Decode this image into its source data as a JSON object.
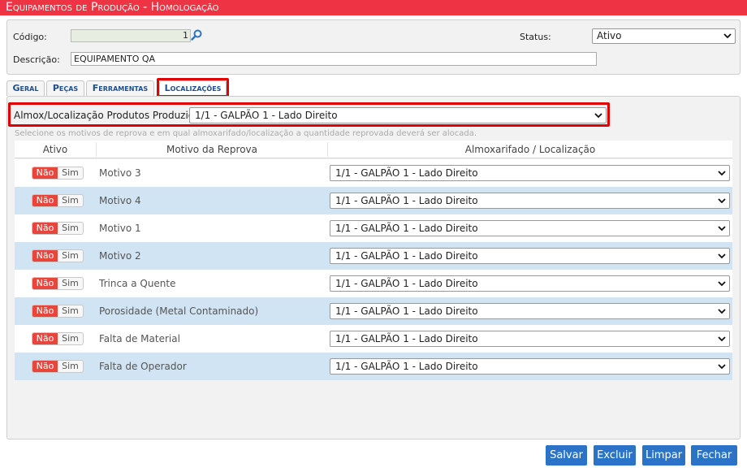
{
  "title": "Equipamentos de Produção  - Homologação",
  "header": {
    "codigo_label": "Código:",
    "codigo_value": "1",
    "descricao_label": "Descrição:",
    "descricao_value": "EQUIPAMENTO QA",
    "status_label": "Status:",
    "status_value": "Ativo"
  },
  "tabs": [
    {
      "label": "Geral",
      "active": false
    },
    {
      "label": "Peças",
      "active": false
    },
    {
      "label": "Ferramentas",
      "active": false
    },
    {
      "label": "Localizações",
      "active": true
    }
  ],
  "localizacoes": {
    "almox_label": "Almox/Localização Produtos Produzidos:",
    "almox_value": "1/1 - GALPÃO 1 - Lado Direito",
    "hint": "Selecione os motivos de reprova e em qual almoxarifado/localização a quantidade reprovada deverá ser alocada.",
    "columns": [
      "Ativo",
      "Motivo da Reprova",
      "Almoxarifado / Localização"
    ],
    "toggle_off_label": "Não",
    "toggle_on_label": "Sim",
    "rows": [
      {
        "motivo": "Motivo 3",
        "ativo": "Não",
        "local": "1/1 - GALPÃO 1 - Lado Direito"
      },
      {
        "motivo": "Motivo 4",
        "ativo": "Não",
        "local": "1/1 - GALPÃO 1 - Lado Direito"
      },
      {
        "motivo": "Motivo 1",
        "ativo": "Não",
        "local": "1/1 - GALPÃO 1 - Lado Direito"
      },
      {
        "motivo": "Motivo 2",
        "ativo": "Não",
        "local": "1/1 - GALPÃO 1 - Lado Direito"
      },
      {
        "motivo": "Trinca a Quente",
        "ativo": "Não",
        "local": "1/1 - GALPÃO 1 - Lado Direito"
      },
      {
        "motivo": "Porosidade (Metal Contaminado)",
        "ativo": "Não",
        "local": "1/1 - GALPÃO 1 - Lado Direito"
      },
      {
        "motivo": "Falta de Material",
        "ativo": "Não",
        "local": "1/1 - GALPÃO 1 - Lado Direito"
      },
      {
        "motivo": "Falta de Operador",
        "ativo": "Não",
        "local": "1/1 - GALPÃO 1 - Lado Direito"
      }
    ]
  },
  "buttons": {
    "salvar": "Salvar",
    "excluir": "Excluir",
    "limpar": "Limpar",
    "fechar": "Fechar"
  },
  "colors": {
    "title_bar": "#ee3344",
    "accent_blue": "#2b73c6",
    "row_alt": "#d0e4f3",
    "toggle_off": "#e8453c",
    "highlight": "#e00000"
  }
}
